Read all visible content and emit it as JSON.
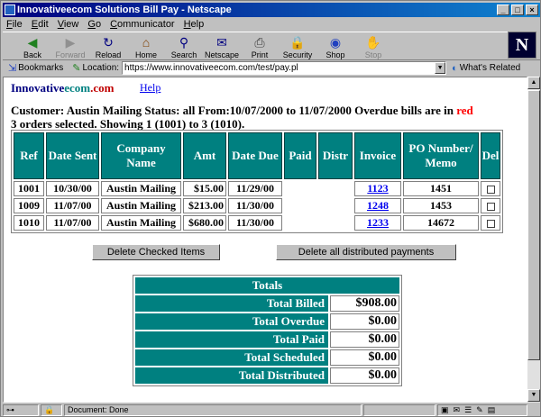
{
  "window": {
    "title": "Innovativeecom Solutions Bill Pay - Netscape"
  },
  "menu": [
    "File",
    "Edit",
    "View",
    "Go",
    "Communicator",
    "Help"
  ],
  "toolbar": [
    {
      "label": "Back",
      "icon": "back-arrow-icon",
      "glyph": "◀",
      "color": "#208020",
      "enabled": true
    },
    {
      "label": "Forward",
      "icon": "forward-arrow-icon",
      "glyph": "▶",
      "color": "#909090",
      "enabled": false
    },
    {
      "label": "Reload",
      "icon": "reload-icon",
      "glyph": "↻",
      "color": "#000080",
      "enabled": true
    },
    {
      "label": "Home",
      "icon": "home-icon",
      "glyph": "⌂",
      "color": "#804000",
      "enabled": true
    },
    {
      "label": "Search",
      "icon": "search-icon",
      "glyph": "⚲",
      "color": "#000080",
      "enabled": true
    },
    {
      "label": "Netscape",
      "icon": "netscape-icon",
      "glyph": "✉",
      "color": "#000080",
      "enabled": true
    },
    {
      "label": "Print",
      "icon": "print-icon",
      "glyph": "⎙",
      "color": "#404040",
      "enabled": true
    },
    {
      "label": "Security",
      "icon": "lock-icon",
      "glyph": "🔒",
      "color": "#c08000",
      "enabled": true
    },
    {
      "label": "Shop",
      "icon": "shop-icon",
      "glyph": "◉",
      "color": "#2040c0",
      "enabled": true
    },
    {
      "label": "Stop",
      "icon": "stop-icon",
      "glyph": "✋",
      "color": "#909090",
      "enabled": false
    }
  ],
  "location": {
    "bookmarks_label": "Bookmarks",
    "location_label": "Location:",
    "url": "https://www.innovativeecom.com/test/pay.pl",
    "whats_related": "What's Related"
  },
  "page": {
    "brand_part1": "Innovative",
    "brand_part2": "ecom",
    "brand_part3": ".com",
    "help_link": "Help",
    "info_line1": "Customer: Austin Mailing Status: all From:10/07/2000 to 11/07/2000 Overdue bills are in ",
    "info_red": "red",
    "info_line2": "3 orders selected. Showing 1 (1001) to 3 (1010).",
    "columns": [
      "Ref",
      "Date Sent",
      "Company Name",
      "Amt",
      "Date Due",
      "Paid",
      "Distr",
      "Invoice",
      "PO Number/ Memo",
      "Del"
    ],
    "rows": [
      {
        "ref": "1001",
        "date_sent": "10/30/00",
        "company": "Austin Mailing",
        "amt": "$15.00",
        "date_due": "11/29/00",
        "paid": "",
        "distr": "",
        "invoice": "1123",
        "po": "1451"
      },
      {
        "ref": "1009",
        "date_sent": "11/07/00",
        "company": "Austin Mailing",
        "amt": "$213.00",
        "date_due": "11/30/00",
        "paid": "",
        "distr": "",
        "invoice": "1248",
        "po": "1453"
      },
      {
        "ref": "1010",
        "date_sent": "11/07/00",
        "company": "Austin Mailing",
        "amt": "$680.00",
        "date_due": "11/30/00",
        "paid": "",
        "distr": "",
        "invoice": "1233",
        "po": "14672"
      }
    ],
    "delete_checked_label": "Delete Checked Items",
    "delete_distributed_label": "Delete all distributed payments",
    "totals": {
      "title": "Totals",
      "items": [
        {
          "label": "Total Billed",
          "value": "$908.00"
        },
        {
          "label": "Total Overdue",
          "value": "$0.00"
        },
        {
          "label": "Total Paid",
          "value": "$0.00"
        },
        {
          "label": "Total Scheduled",
          "value": "$0.00"
        },
        {
          "label": "Total Distributed",
          "value": "$0.00"
        }
      ]
    }
  },
  "status": {
    "text": "Document: Done"
  },
  "colors": {
    "header_teal": "#008080",
    "overdue_red": "#ff0000",
    "title_blue": "#000080"
  }
}
